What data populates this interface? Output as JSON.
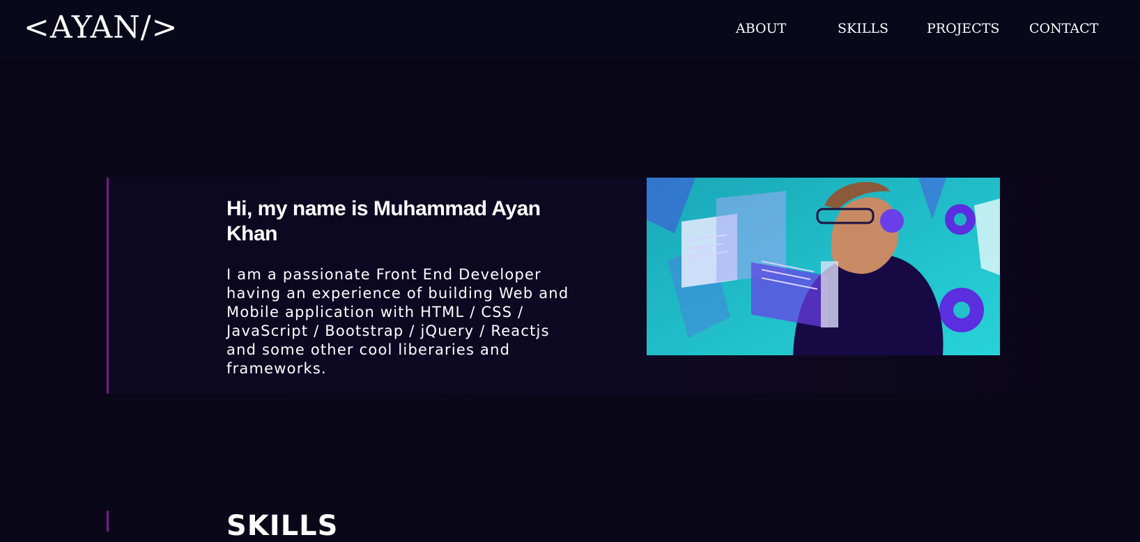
{
  "nav": {
    "logo": "<AYAN/>",
    "items": [
      "ABOUT",
      "SKILLS",
      "PROJECTS",
      "CONTACT"
    ]
  },
  "about": {
    "title": "Hi, my name is Muhammad Ayan Khan",
    "description": "I am a passionate Front End Developer having an experience of building Web and Mobile application with HTML / CSS / JavaScript / Bootstrap / jQuery / Reactjs and some other cool liberaries and frameworks."
  },
  "skills": {
    "title": "SKILLS"
  },
  "colors": {
    "background": "#0a0719",
    "accent": "#7a1b8c",
    "image_teal": "#1fb6c4",
    "image_purple": "#5b2ee0"
  },
  "icons": {
    "hero_image": "developer-with-headphones-illustration"
  }
}
